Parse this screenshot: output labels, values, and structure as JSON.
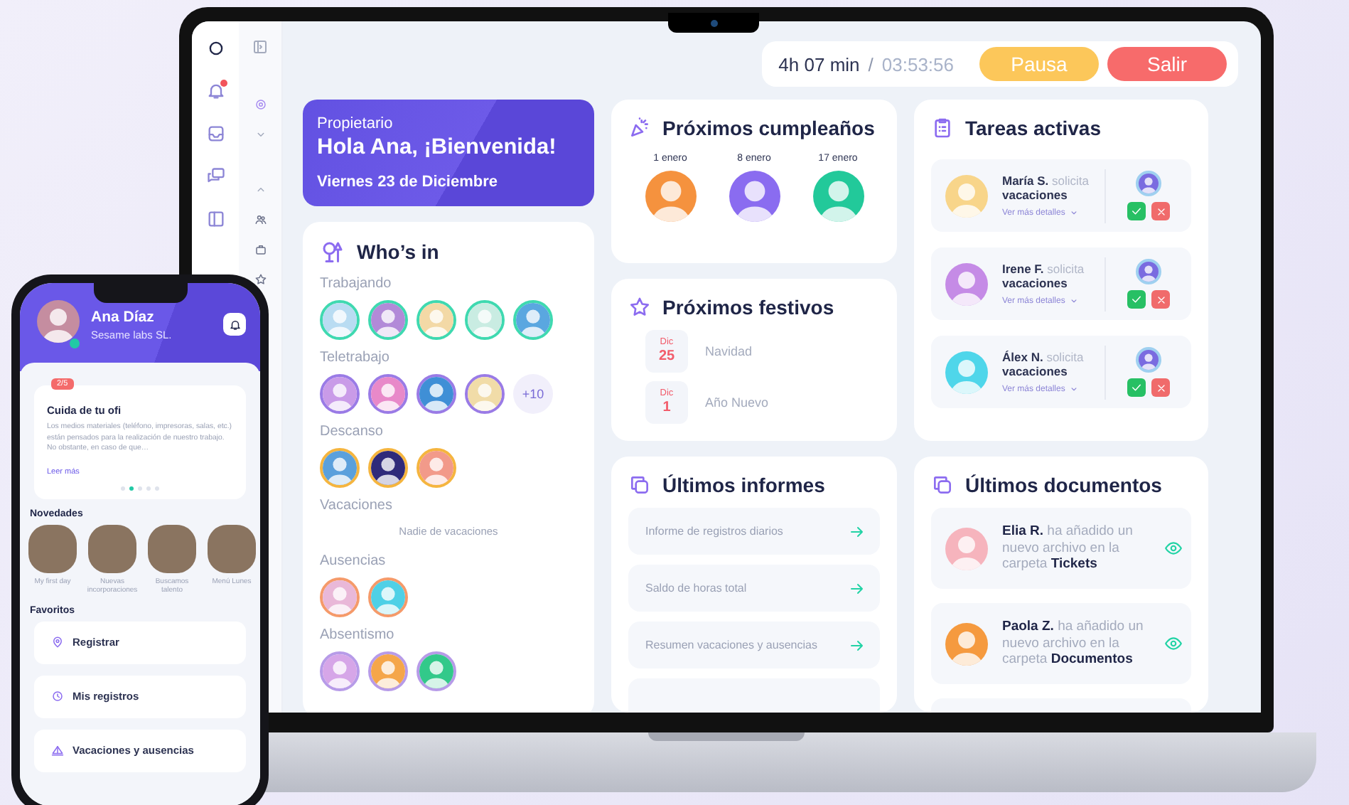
{
  "laptop": {
    "top_bar": {
      "worked": "4h 07 min",
      "separator": "/",
      "timer": "03:53:56",
      "buttons": [
        {
          "label": "Pausa",
          "kind": "pause"
        },
        {
          "label": "Salir",
          "kind": "exit"
        }
      ]
    },
    "welcome": {
      "role": "Propietario",
      "greeting": "Hola Ana, ¡Bienvenida!",
      "date": "Viernes 23 de Diciembre"
    },
    "whos_in": {
      "title": "Who’s in",
      "groups": [
        {
          "label": "Trabajando",
          "color": "#3fd9b0",
          "avatars": [
            {
              "color": "#b9dcf2"
            },
            {
              "color": "#b28ad8"
            },
            {
              "color": "#f3d9a6"
            },
            {
              "color": "#c9ece2"
            },
            {
              "color": "#5aa7e0"
            }
          ]
        },
        {
          "label": "Teletrabajo",
          "color": "#9a7be6",
          "avatars": [
            {
              "color": "#c99be8"
            },
            {
              "color": "#e889c9"
            },
            {
              "color": "#3f8fd6"
            },
            {
              "color": "#f1dca8"
            }
          ],
          "more": "+10"
        },
        {
          "label": "Descanso",
          "color": "#f5b53f",
          "avatars": [
            {
              "color": "#5aa0dc"
            },
            {
              "color": "#2f2a7a"
            },
            {
              "color": "#f29a8a"
            }
          ]
        },
        {
          "label": "Vacaciones",
          "empty": "Nadie de vacaciones"
        },
        {
          "label": "Ausencias",
          "color": "#f59a6a",
          "avatars": [
            {
              "color": "#e9b8d8"
            },
            {
              "color": "#4fd0e6"
            }
          ]
        },
        {
          "label": "Absentismo",
          "color": "#b79be8",
          "avatars": [
            {
              "color": "#d6a6e8"
            },
            {
              "color": "#f5a64a"
            },
            {
              "color": "#32c98a"
            }
          ]
        }
      ]
    },
    "birthdays": {
      "title": "Próximos cumpleaños",
      "people": [
        {
          "date": "1 enero",
          "color": "#f5923e"
        },
        {
          "date": "8 enero",
          "color": "#8a6cf0"
        },
        {
          "date": "17 enero",
          "color": "#22c99a"
        }
      ]
    },
    "holidays": {
      "title": "Próximos festivos",
      "items": [
        {
          "month": "Dic",
          "day": "25",
          "name": "Navidad"
        },
        {
          "month": "Dic",
          "day": "1",
          "name": "Año Nuevo"
        }
      ]
    },
    "reports": {
      "title": "Últimos informes",
      "items": [
        "Informe de registros diarios",
        "Saldo de horas total",
        "Resumen vacaciones y ausencias"
      ]
    },
    "tasks": {
      "title": "Tareas activas",
      "items": [
        {
          "name": "María S.",
          "verb": "solicita",
          "object": "vacaciones",
          "link": "Ver más detalles",
          "color": "#f8d58a"
        },
        {
          "name": "Irene F.",
          "verb": "solicita",
          "object": "vacaciones",
          "link": "Ver más detalles",
          "color": "#c58be6"
        },
        {
          "name": "Álex N.",
          "verb": "solicita",
          "object": "vacaciones",
          "link": "Ver más detalles",
          "color": "#4fd6ea"
        }
      ]
    },
    "documents": {
      "title": "Últimos documentos",
      "items": [
        {
          "text": "**Elia R.** ha añadido un nuevo archivo en la carpeta **Tickets**",
          "color": "#f6b4bd"
        },
        {
          "text": "**Paola Z.** ha añadido un nuevo archivo en la carpeta **Documentos**",
          "color": "#f59a3f"
        }
      ]
    }
  },
  "phone": {
    "user": {
      "name": "Ana Díaz",
      "company": "Sesame labs SL."
    },
    "tip": {
      "badge": "2/5",
      "title": "Cuida de tu ofi",
      "body": "Los medios materiales (teléfono, impresoras, salas, etc.) están pensados para la realización de nuestro trabajo. No obstante, en caso de que…",
      "link": "Leer más",
      "dots": [
        {
          "selected": false
        },
        {
          "selected": true
        },
        {
          "selected": false
        },
        {
          "selected": false
        },
        {
          "selected": false
        }
      ]
    },
    "news_title": "Novedades",
    "news": [
      "My first day",
      "Nuevas incorporaciones",
      "Buscamos talento",
      "Menú Lunes"
    ],
    "favorites_title": "Favoritos",
    "favorites": [
      {
        "label": "Registrar",
        "kind": "location"
      },
      {
        "label": "Mis registros",
        "kind": "clock"
      },
      {
        "label": "Vacaciones y ausencias",
        "kind": "beach"
      }
    ]
  }
}
